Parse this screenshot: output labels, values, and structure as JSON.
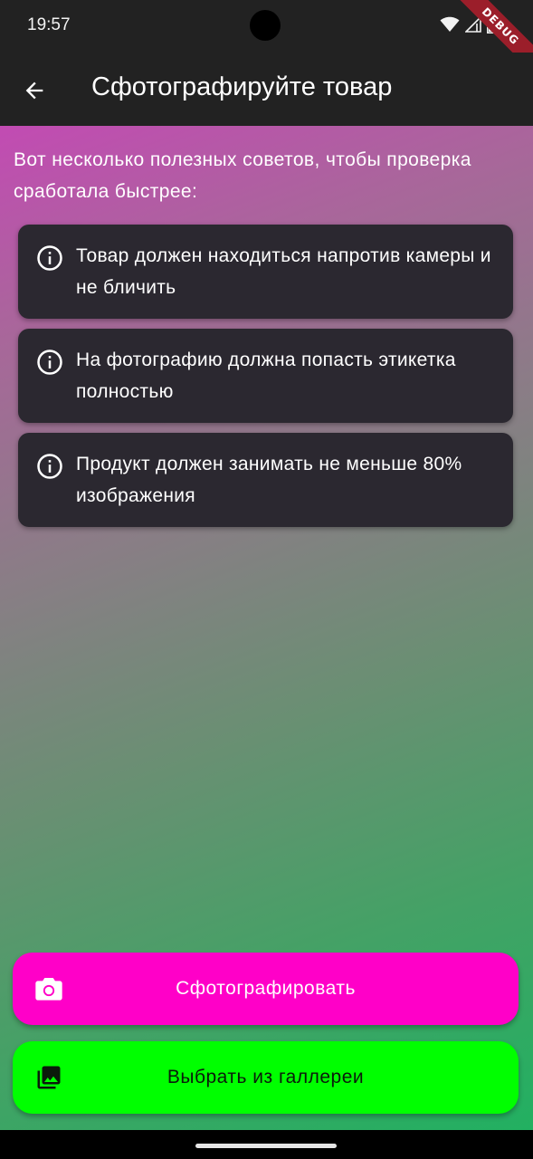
{
  "status_bar": {
    "time": "19:57",
    "icons": [
      "wifi-icon",
      "signal-icon",
      "battery-icon"
    ],
    "debug_label": "DEBUG"
  },
  "app_bar": {
    "title": "Сфотографируйте товар",
    "back_icon": "arrow-left-icon"
  },
  "intro": "Вот несколько полезных советов, чтобы проверка сработала быстрее:",
  "tips": [
    {
      "icon": "info-icon",
      "text": "Товар должен находиться напротив камеры и не бличить"
    },
    {
      "icon": "info-icon",
      "text": "На фотографию должна попасть этикетка полностью"
    },
    {
      "icon": "info-icon",
      "text": "Продукт должен занимать не меньше 80% изображения"
    }
  ],
  "actions": {
    "take_photo": {
      "label": "Сфотографировать",
      "icon": "camera-icon",
      "color": "#ff00c8"
    },
    "pick_gallery": {
      "label": "Выбрать из галлереи",
      "icon": "photo-library-icon",
      "color": "#00ff00"
    }
  },
  "colors": {
    "bar_background": "#222222",
    "card_background": "#2b2830",
    "gradient_top": "#c24bb3",
    "gradient_bottom": "#22b061"
  }
}
